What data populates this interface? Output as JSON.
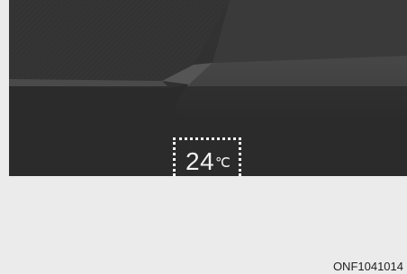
{
  "display": {
    "temperature_value": "24",
    "temperature_unit": "℃"
  },
  "figure": {
    "code": "ONF1041014"
  },
  "colors": {
    "dashboard": "#2d2d2d",
    "panel": "#3f3f3f",
    "background": "#ebebeb",
    "highlight": "#ffffff"
  },
  "icons": {
    "dashboard_image": "dashboard-panel-illustration"
  }
}
